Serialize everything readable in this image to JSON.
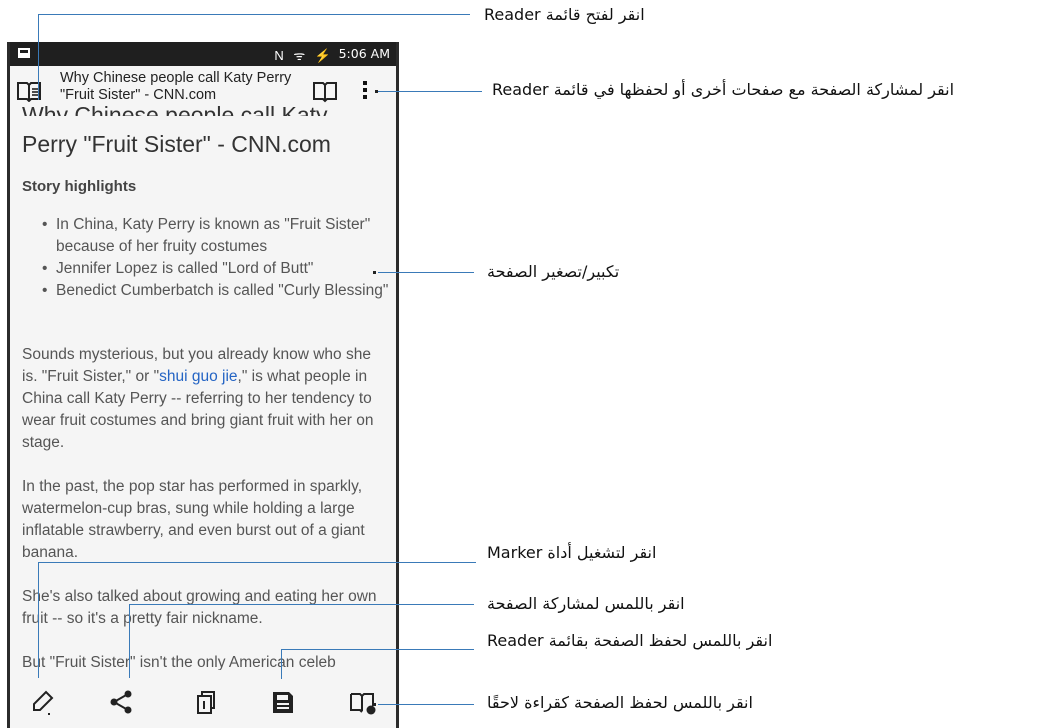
{
  "status_bar": {
    "time": "5:06 AM",
    "icons": "N ᯤ ⚡"
  },
  "toolbar": {
    "title": "Why Chinese people call Katy Perry \"Fruit Sister\" - CNN.com"
  },
  "article": {
    "cut_heading": "Why Chinese people call Katy",
    "heading": "Perry \"Fruit Sister\" - CNN.com",
    "highlights_title": "Story highlights",
    "bullets": [
      "In China, Katy Perry is known as \"Fruit Sister\" because of her fruity costumes",
      "Jennifer Lopez is called \"Lord of Butt\"",
      "Benedict Cumberbatch is called \"Curly Blessing\""
    ],
    "para1_a": "Sounds mysterious, but you already know who she is. \"Fruit Sister,\" or \"",
    "para1_link": "shui guo jie",
    "para1_b": ",\" is what people in China call Katy Perry -- referring to her tendency to wear fruit costumes and bring giant fruit with her on stage.",
    "para2": "In the past, the pop star has performed in sparkly, watermelon-cup bras, sung while holding a large inflatable strawberry, and even burst out of a giant banana.",
    "para3": "She's also talked about growing and eating her own fruit -- so it's a pretty fair nickname.",
    "para4": "But \"Fruit Sister\" isn't the only American celeb"
  },
  "callouts": {
    "open_reader_list": "انقر لفتح قائمة Reader",
    "share_or_save": "انقر لمشاركة الصفحة مع صفحات أخرى أو لحفظها في قائمة Reader",
    "zoom": "تكبير/تصغير الصفحة",
    "marker": "انقر لتشغيل أداة Marker",
    "share": "انقر باللمس لمشاركة الصفحة",
    "save_reader": "انقر باللمس لحفظ الصفحة بقائمة Reader",
    "read_later": "انقر باللمس لحفظ الصفحة كقراءة لاحقًا"
  },
  "colors": {
    "callout_line": "#3a7ab8",
    "link": "#2464c4"
  }
}
